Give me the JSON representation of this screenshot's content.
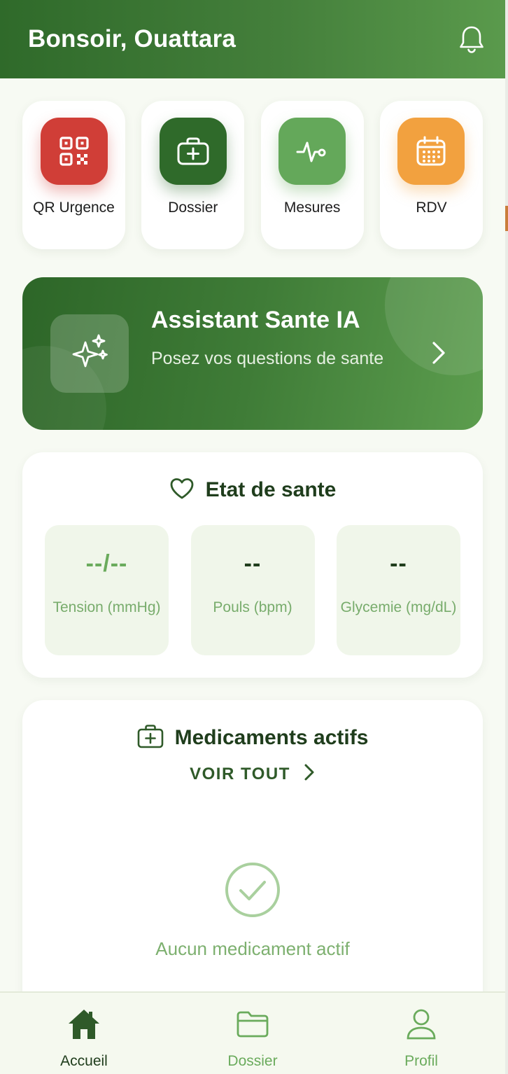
{
  "header": {
    "greeting": "Bonsoir, Ouattara",
    "bell_icon": "bell-icon"
  },
  "quick_actions": [
    {
      "label": "QR Urgence",
      "icon": "qr-code-icon",
      "color": "#d03e37"
    },
    {
      "label": "Dossier",
      "icon": "medical-briefcase-icon",
      "color": "#2f6a2a"
    },
    {
      "label": "Mesures",
      "icon": "heart-pulse-icon",
      "color": "#64a85a"
    },
    {
      "label": "RDV",
      "icon": "calendar-icon",
      "color": "#f2a13f"
    }
  ],
  "assistant": {
    "title": "Assistant Sante IA",
    "subtitle": "Posez vos questions de sante",
    "icon": "sparkles-icon"
  },
  "health": {
    "title": "Etat de sante",
    "icon": "heart-outline-icon",
    "metrics": [
      {
        "value": "--/--",
        "label": "Tension (mmHg)"
      },
      {
        "value": "--",
        "label": "Pouls (bpm)"
      },
      {
        "value": "--",
        "label": "Glycemie (mg/dL)"
      }
    ]
  },
  "medications": {
    "title": "Medicaments actifs",
    "icon": "medical-briefcase-icon",
    "see_all": "VOIR TOUT",
    "empty_text": "Aucun medicament actif"
  },
  "nav": [
    {
      "label": "Accueil",
      "icon": "home-icon",
      "active": true
    },
    {
      "label": "Dossier",
      "icon": "folder-icon",
      "active": false
    },
    {
      "label": "Profil",
      "icon": "user-icon",
      "active": false
    }
  ],
  "colors": {
    "primary": "#2f6a2a",
    "accent_green": "#6aab5c",
    "background": "#f7faf3"
  }
}
